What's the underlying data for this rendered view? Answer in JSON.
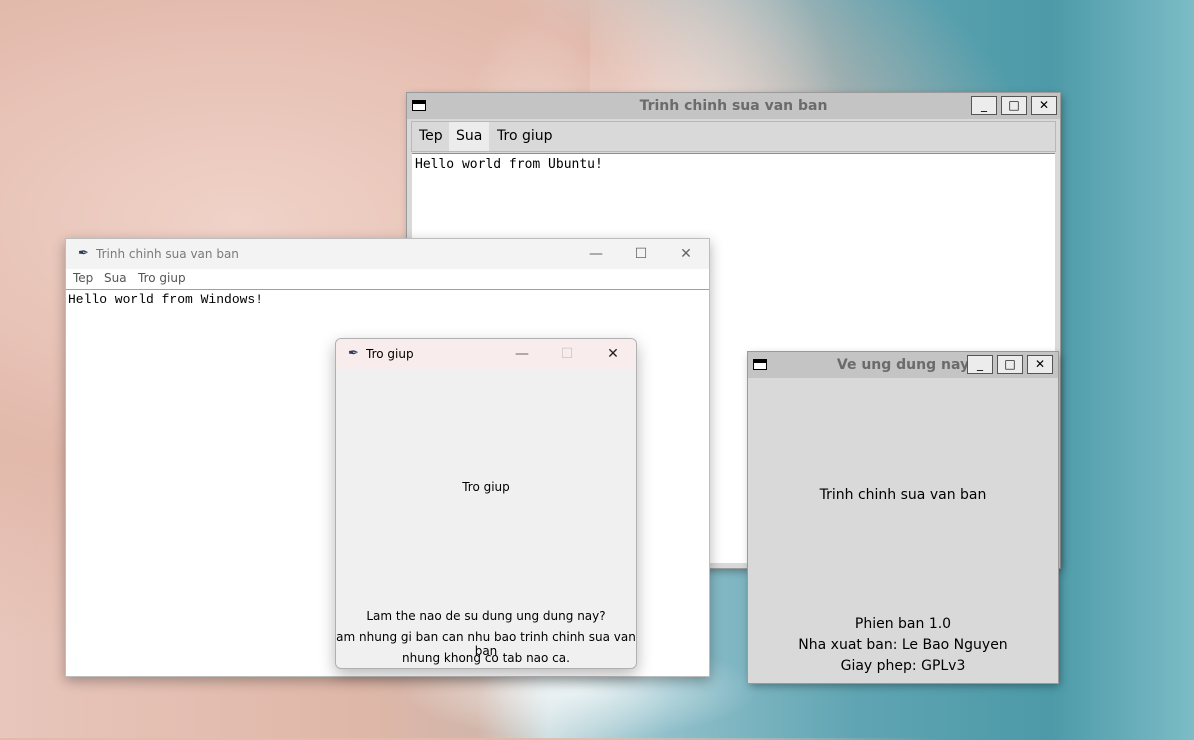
{
  "ubuntu_editor": {
    "title": "Trinh chinh sua van ban",
    "menu": [
      "Tep",
      "Sua",
      "Tro giup"
    ],
    "text": "Hello world from Ubuntu!",
    "controls": {
      "minimize": "_",
      "maximize": "□",
      "close": "✕"
    }
  },
  "windows_editor": {
    "title": "Trinh chinh sua van ban",
    "menu": [
      "Tep",
      "Sua",
      "Tro giup"
    ],
    "text": "Hello world from Windows!",
    "controls": {
      "minimize": "—",
      "maximize": "☐",
      "close": "✕"
    }
  },
  "help_dialog": {
    "title": "Tro giup",
    "heading": "Tro giup",
    "lines": [
      "Lam the nao de su dung ung dung nay?",
      "am nhung gi ban can nhu bao trinh chinh sua van ban",
      "nhung khong co tab nao ca."
    ],
    "controls": {
      "minimize": "—",
      "maximize": "☐",
      "close": "✕"
    }
  },
  "about_dialog": {
    "title": "Ve ung dung nay",
    "app_name": "Trinh chinh sua van ban",
    "version": "Phien ban 1.0",
    "publisher": "Nha xuat ban: Le Bao Nguyen",
    "license": "Giay phep: GPLv3",
    "controls": {
      "minimize": "_",
      "maximize": "□",
      "close": "✕"
    }
  },
  "icons": [
    "window-icon",
    "feather-icon",
    "minimize-icon",
    "maximize-icon",
    "close-icon"
  ]
}
